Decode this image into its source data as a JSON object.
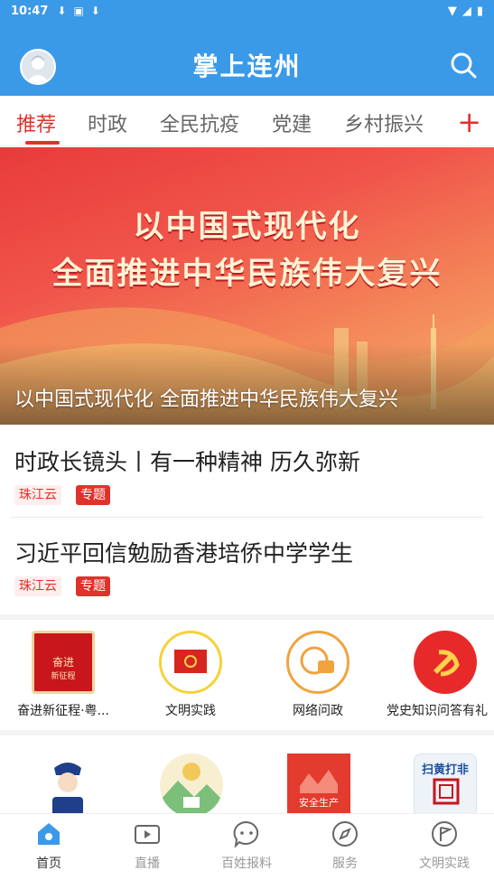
{
  "status_bar": {
    "time": "10:47"
  },
  "app": {
    "title": "掌上连州"
  },
  "tabs": [
    {
      "label": "推荐",
      "active": true
    },
    {
      "label": "时政"
    },
    {
      "label": "全民抗疫"
    },
    {
      "label": "党建"
    },
    {
      "label": "乡村振兴"
    }
  ],
  "tab_add_label": "+",
  "banner": {
    "slogan_line1": "以中国式现代化",
    "slogan_line2": "全面推进中华民族伟大复兴",
    "caption": "以中国式现代化 全面推进中华民族伟大复兴"
  },
  "news": [
    {
      "title": "时政长镜头丨有一种精神 历久弥新",
      "source": "珠江云",
      "tag": "专题"
    },
    {
      "title": "习近平回信勉励香港培侨中学学生",
      "source": "珠江云",
      "tag": "专题"
    }
  ],
  "quick_links": [
    {
      "label": "奋进新征程·粤...",
      "icon": "new-journey-icon"
    },
    {
      "label": "文明实践",
      "icon": "party-flag-icon"
    },
    {
      "label": "网络问政",
      "icon": "web-politics-icon"
    },
    {
      "label": "党史知识问答有礼",
      "icon": "party-emblem-icon"
    }
  ],
  "service_icons": [
    {
      "icon": "police-icon"
    },
    {
      "icon": "village-icon"
    },
    {
      "icon": "safety-production-icon",
      "text": "安全生产"
    },
    {
      "icon": "anti-porn-icon",
      "text": "扫黄打非"
    }
  ],
  "bottom_nav": [
    {
      "label": "首页",
      "icon": "home-icon",
      "active": true
    },
    {
      "label": "直播",
      "icon": "video-icon"
    },
    {
      "label": "百姓报料",
      "icon": "chat-icon"
    },
    {
      "label": "服务",
      "icon": "compass-icon"
    },
    {
      "label": "文明实践",
      "icon": "flag-icon"
    }
  ],
  "colors": {
    "brand_blue": "#3a9ae8",
    "accent_red": "#e0322b"
  }
}
